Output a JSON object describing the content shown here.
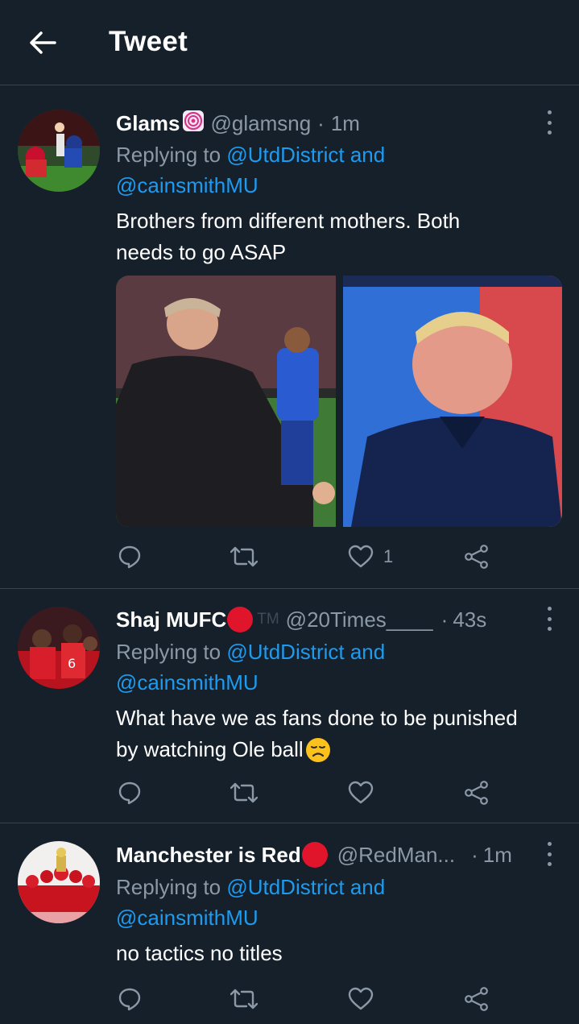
{
  "header": {
    "title": "Tweet"
  },
  "tweets": [
    {
      "name": "Glams",
      "badge_icon": "spiral-emoji-icon",
      "handle": "@glamsng",
      "dot": "·",
      "time": "1m",
      "replying_prefix": "Replying to ",
      "replying_link1": "@UtdDistrict and",
      "replying_link2": "@cainsmithMU",
      "text_line1": "Brothers from different mothers. Both",
      "text_line2": "needs to go ASAP",
      "media": [
        "coach-celebrating-photo",
        "smiling-coach-photo"
      ],
      "likes": "1"
    },
    {
      "name": "Shaj MUFC",
      "badge_icon": "red-circle-icon",
      "tm": "TM",
      "handle": "@20Times____",
      "dot": "·",
      "time": "43s",
      "replying_prefix": "Replying to ",
      "replying_link1": "@UtdDistrict and",
      "replying_link2": "@cainsmithMU",
      "text_line1": "What have we as fans done to be punished",
      "text_line2": "by watching Ole ball",
      "emoji_icon": "disappointed-face-icon"
    },
    {
      "name": "Manchester is Red",
      "badge_icon": "red-circle-icon",
      "handle": "@RedMan...",
      "dot": "·",
      "time": "1m",
      "replying_prefix": "Replying to ",
      "replying_link1": "@UtdDistrict and",
      "replying_link2": "@cainsmithMU",
      "text_line1": "no tactics no titles"
    }
  ],
  "colors": {
    "background": "#15202b",
    "link": "#1d9bf0",
    "secondary_text": "#8b98a5",
    "divider": "#38444d"
  }
}
